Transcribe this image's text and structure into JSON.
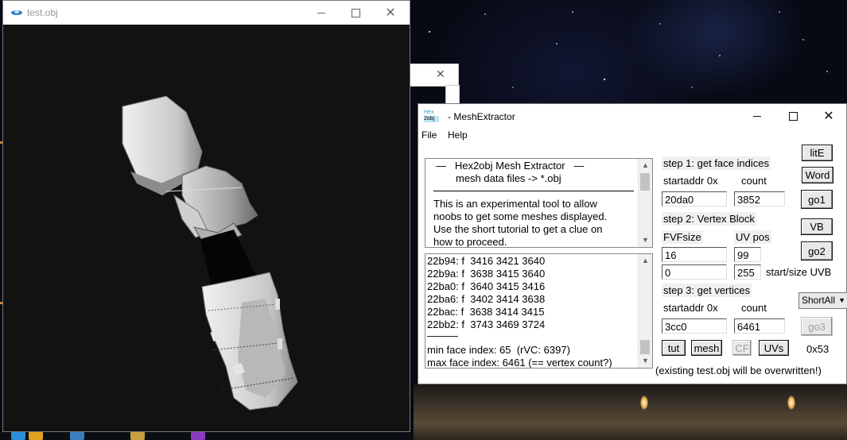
{
  "viewer": {
    "title": "test.obj"
  },
  "hidden_window": {
    "close": "✕"
  },
  "extractor": {
    "title": "- MeshExtractor",
    "app_icon": {
      "line1": "Hex",
      "line2": "2obj"
    },
    "menu": [
      "File",
      "Help"
    ],
    "info": {
      "heading": "—   Hex2obj Mesh Extractor   —",
      "subheading": "mesh data files -> *.obj",
      "lines": [
        "This is an experimental tool to allow",
        "noobs to get some meshes displayed.",
        "Use the short tutorial to get a clue on",
        "how to proceed."
      ]
    },
    "log": {
      "lines": [
        "22b94: f  3416 3421 3640",
        "22b9a: f  3638 3415 3640",
        "22ba0: f  3640 3415 3416",
        "22ba6: f  3402 3414 3638",
        "22bac: f  3638 3414 3415",
        "22bb2: f  3743 3469 3724"
      ],
      "separator": "———",
      "min": "min face index: 65  (rVC: 6397)",
      "max": "max face index: 6461 (== vertex count?)"
    },
    "step1": {
      "label": "step 1: get face indices",
      "startaddr_label": "startaddr 0x",
      "count_label": "count",
      "startaddr": "20da0",
      "count": "3852",
      "go": "go1"
    },
    "step2": {
      "label": "step 2: Vertex Block",
      "fvf_label": "FVFsize",
      "uvpos_label": "UV pos",
      "fvf": "16",
      "uvpos": "99",
      "start": "0",
      "size": "255",
      "startsize_label": "start/size UVB",
      "vb": "VB",
      "go": "go2"
    },
    "step3": {
      "label": "step 3: get vertices",
      "startaddr_label": "startaddr 0x",
      "count_label": "count",
      "startaddr": "3cc0",
      "count": "6461",
      "go": "go3"
    },
    "buttons": {
      "lite": "litE",
      "word": "Word",
      "tut": "tut",
      "mesh": "mesh",
      "cf": "CF",
      "uvs": "UVs"
    },
    "mode_select": "ShortAll",
    "hex_label": "0x53",
    "footer": "(existing test.obj will be overwritten!)"
  }
}
